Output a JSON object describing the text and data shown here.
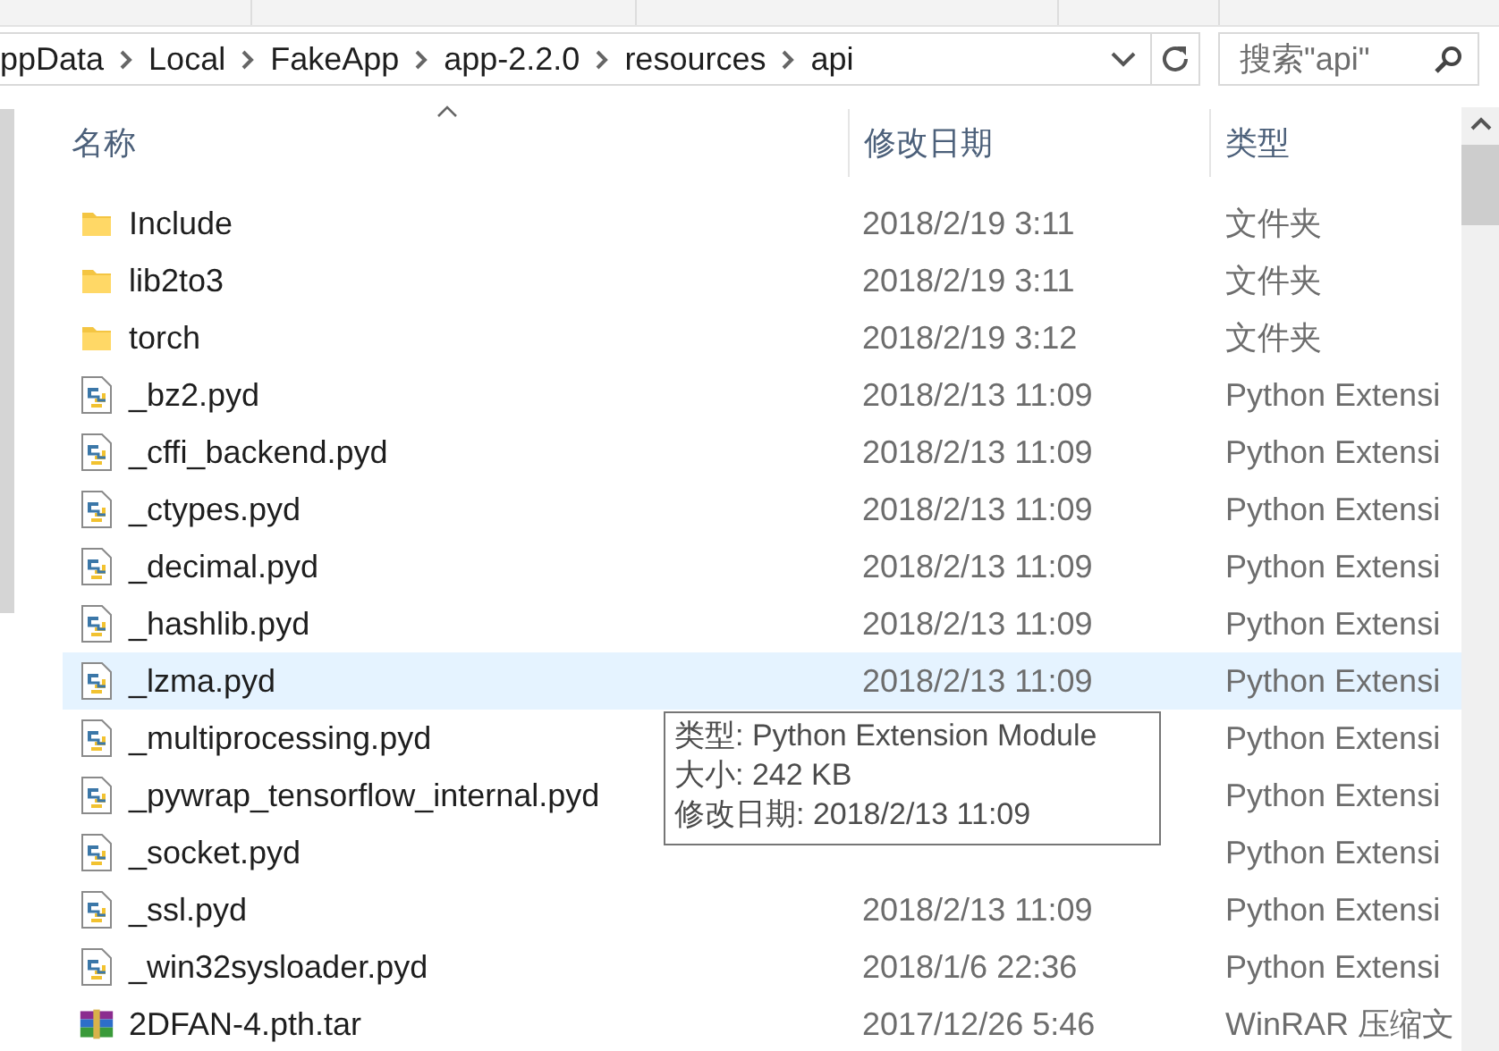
{
  "address_bar": {
    "path": [
      "ppData",
      "Local",
      "FakeApp",
      "app-2.2.0",
      "resources",
      "api"
    ]
  },
  "search": {
    "placeholder": "搜索\"api\""
  },
  "columns": [
    "名称",
    "修改日期",
    "类型"
  ],
  "rows": [
    {
      "kind": "folder",
      "name": "Include",
      "date": "2018/2/19 3:11",
      "type": "文件夹",
      "selected": false
    },
    {
      "kind": "folder",
      "name": "lib2to3",
      "date": "2018/2/19 3:11",
      "type": "文件夹",
      "selected": false
    },
    {
      "kind": "folder",
      "name": "torch",
      "date": "2018/2/19 3:12",
      "type": "文件夹",
      "selected": false
    },
    {
      "kind": "python",
      "name": "_bz2.pyd",
      "date": "2018/2/13 11:09",
      "type": "Python Extensi",
      "selected": false
    },
    {
      "kind": "python",
      "name": "_cffi_backend.pyd",
      "date": "2018/2/13 11:09",
      "type": "Python Extensi",
      "selected": false
    },
    {
      "kind": "python",
      "name": "_ctypes.pyd",
      "date": "2018/2/13 11:09",
      "type": "Python Extensi",
      "selected": false
    },
    {
      "kind": "python",
      "name": "_decimal.pyd",
      "date": "2018/2/13 11:09",
      "type": "Python Extensi",
      "selected": false
    },
    {
      "kind": "python",
      "name": "_hashlib.pyd",
      "date": "2018/2/13 11:09",
      "type": "Python Extensi",
      "selected": false
    },
    {
      "kind": "python",
      "name": "_lzma.pyd",
      "date": "2018/2/13 11:09",
      "type": "Python Extensi",
      "selected": true
    },
    {
      "kind": "python",
      "name": "_multiprocessing.pyd",
      "type": "Python Extensi",
      "selected": false
    },
    {
      "kind": "python",
      "name": "_pywrap_tensorflow_internal.pyd",
      "type": "Python Extensi",
      "selected": false
    },
    {
      "kind": "python",
      "name": "_socket.pyd",
      "type": "Python Extensi",
      "selected": false
    },
    {
      "kind": "python",
      "name": "_ssl.pyd",
      "date": "2018/2/13 11:09",
      "type": "Python Extensi",
      "selected": false
    },
    {
      "kind": "python",
      "name": "_win32sysloader.pyd",
      "date": "2018/1/6 22:36",
      "type": "Python Extensi",
      "selected": false
    },
    {
      "kind": "archive",
      "name": "2DFAN-4.pth.tar",
      "date": "2017/12/26 5:46",
      "type": "WinRAR 压缩文",
      "selected": false
    }
  ],
  "tooltip": {
    "lines": [
      "类型: Python Extension Module",
      "大小: 242 KB",
      "修改日期: 2018/2/13 11:09"
    ]
  }
}
